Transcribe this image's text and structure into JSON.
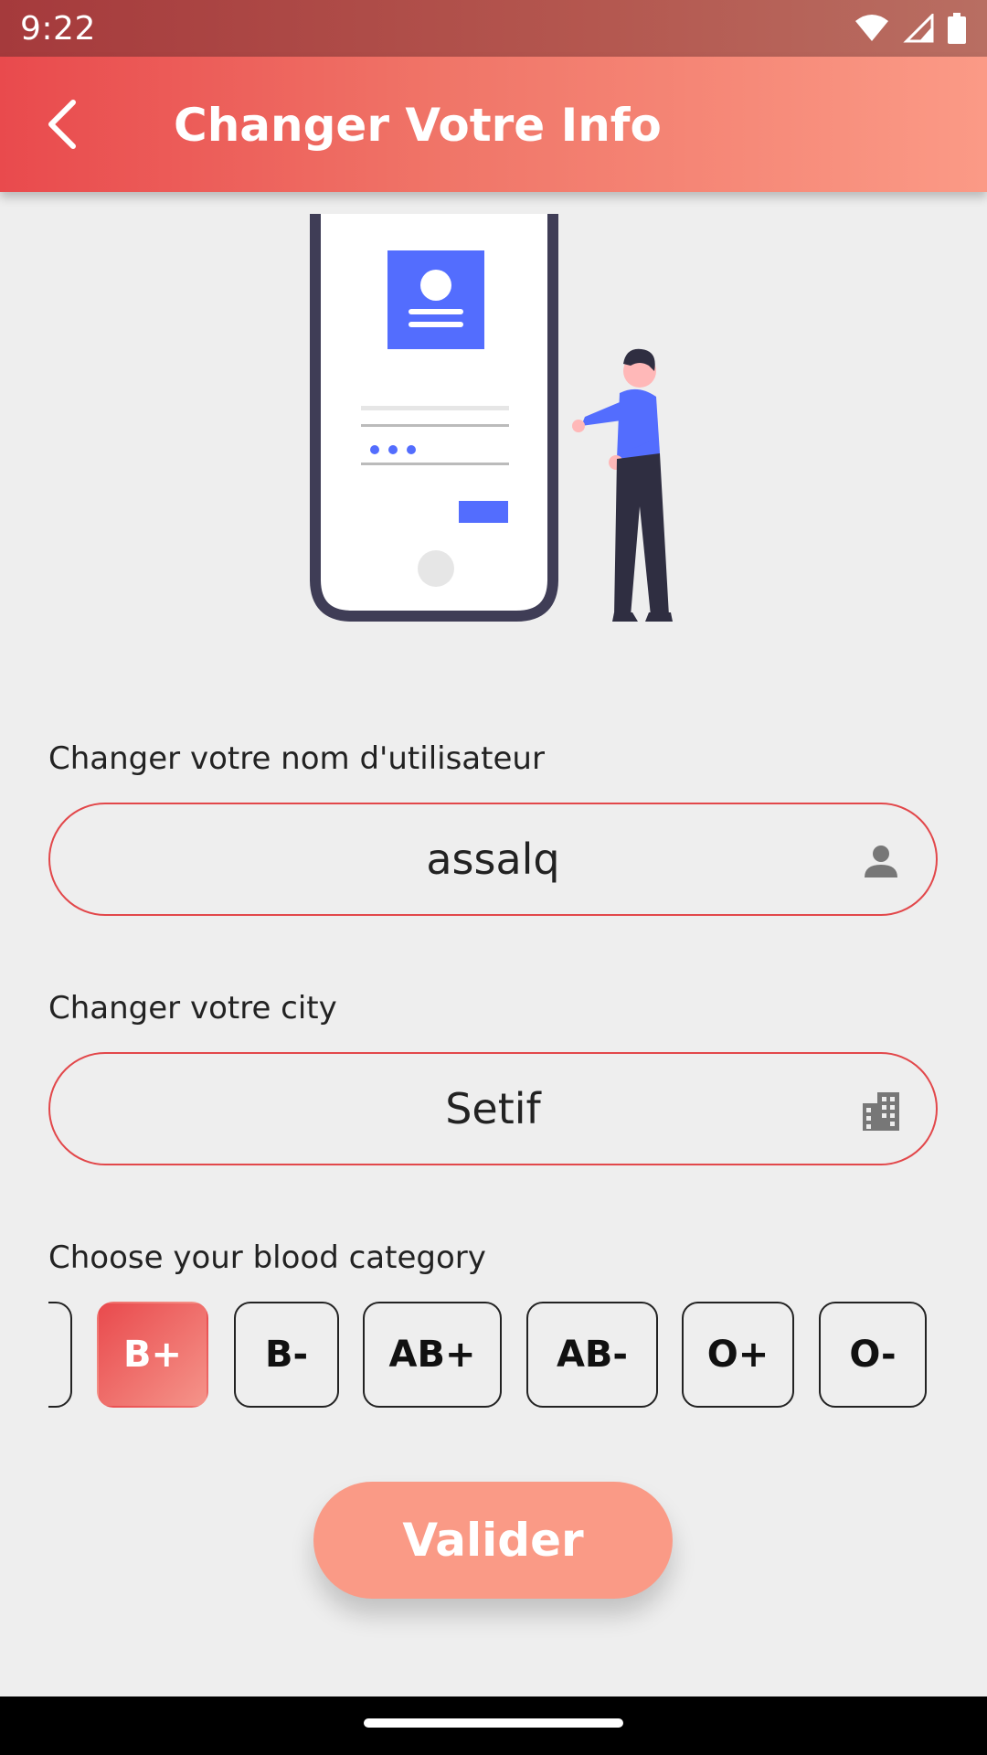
{
  "status_bar": {
    "time": "9:22",
    "icons": [
      "wifi-icon",
      "signal-icon",
      "battery-icon"
    ]
  },
  "app_bar": {
    "back_icon": "chevron-left-icon",
    "title": "Changer Votre Info"
  },
  "username": {
    "label": "Changer votre nom d'utilisateur",
    "value": "assalq",
    "icon": "person-icon"
  },
  "city": {
    "label": "Changer votre city",
    "value": "Setif",
    "icon": "building-icon"
  },
  "blood": {
    "label": "Choose your blood category",
    "options": [
      "",
      "B+",
      "B-",
      "AB+",
      "AB-",
      "O+",
      "O-"
    ],
    "selected": "B+"
  },
  "submit": {
    "label": "Valider"
  },
  "colors": {
    "accent": "#e94a4d",
    "accent_light": "#fa9a86",
    "illustration_blue": "#536dfe",
    "illustration_dark": "#3f3d56"
  }
}
